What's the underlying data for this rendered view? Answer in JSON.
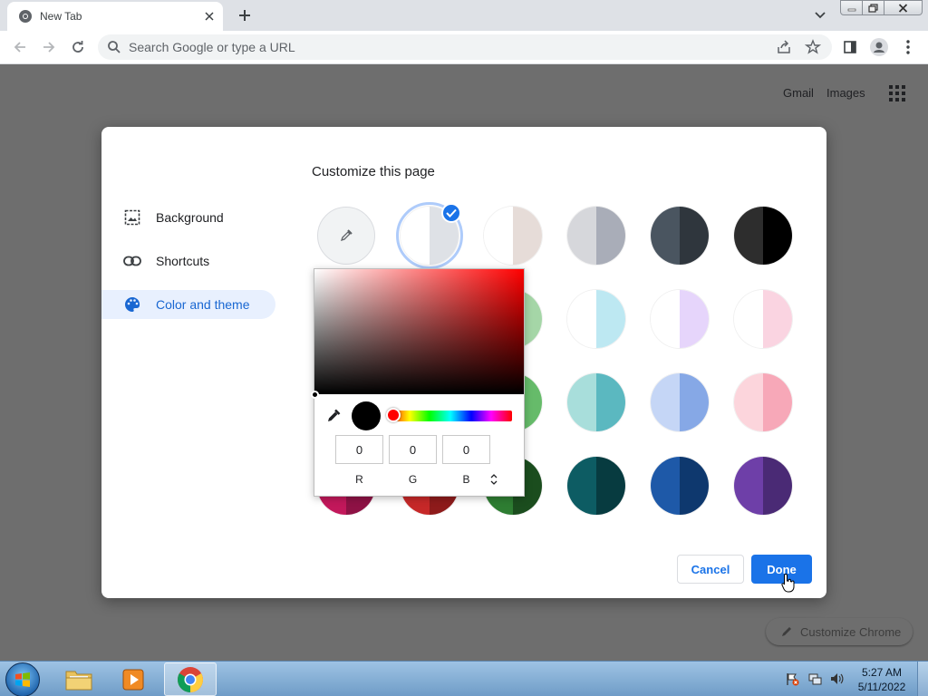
{
  "browser": {
    "tab_title": "New Tab",
    "omnibox_placeholder": "Search Google or type a URL"
  },
  "page": {
    "gmail": "Gmail",
    "images": "Images",
    "customize_chrome": "Customize Chrome"
  },
  "dialog": {
    "title": "Customize this page",
    "menu": [
      {
        "label": "Background",
        "icon": "image-icon"
      },
      {
        "label": "Shortcuts",
        "icon": "link-icon"
      },
      {
        "label": "Color and theme",
        "icon": "palette-icon",
        "active": true
      }
    ],
    "swatches": [
      {
        "left": "#ffffff",
        "right": "#dee1e6",
        "selected": true
      },
      {
        "left": "#ffffff",
        "right": "#e6dcd8"
      },
      {
        "left": "#d6d7db",
        "right": "#a9adb8"
      },
      {
        "left": "#4a5560",
        "right": "#2f363d"
      },
      {
        "left": "#2d2d2d",
        "right": "#000000"
      },
      {
        "left": "#ffffff",
        "right": "#bde8f2"
      },
      {
        "left": "#ffffff",
        "right": "#e6d5fb"
      },
      {
        "left": "#ffffff",
        "right": "#fad4e1"
      },
      {
        "left": "#a8dedb",
        "right": "#5bb8c0"
      },
      {
        "left": "#c5d6f6",
        "right": "#86a8e6"
      },
      {
        "left": "#fcd5dc",
        "right": "#f7a8b8"
      },
      {
        "left": "#0d5c63",
        "right": "#073b40"
      },
      {
        "left": "#1e59a8",
        "right": "#0e386e"
      },
      {
        "left": "#6e3fa8",
        "right": "#4a2a75"
      }
    ],
    "cancel": "Cancel",
    "done": "Done"
  },
  "color_picker": {
    "r": "0",
    "g": "0",
    "b": "0",
    "r_label": "R",
    "g_label": "G",
    "b_label": "B",
    "current_color": "#000000",
    "hue_color": "#ff0000"
  },
  "taskbar": {
    "time": "5:27 AM",
    "date": "5/11/2022"
  },
  "colors": {
    "accent": "#1a73e8",
    "dim_overlay": "#6e6e6e"
  }
}
